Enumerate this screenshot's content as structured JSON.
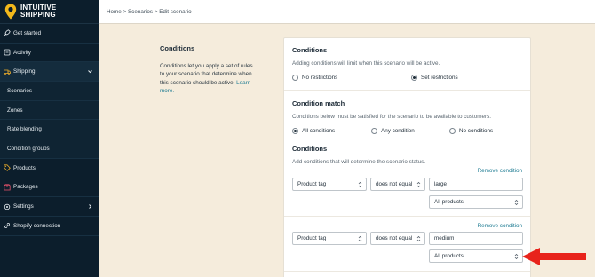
{
  "brand": {
    "line1": "INTUITIVE",
    "line2": "SHIPPING"
  },
  "sidebar": {
    "items": [
      {
        "label": "Get started",
        "icon": "rocket-icon",
        "type": "main"
      },
      {
        "label": "Activity",
        "icon": "activity-icon",
        "type": "main"
      },
      {
        "label": "Shipping",
        "icon": "truck-icon",
        "type": "main",
        "expanded": true
      },
      {
        "label": "Scenarios",
        "type": "sub"
      },
      {
        "label": "Zones",
        "type": "sub"
      },
      {
        "label": "Rate blending",
        "type": "sub"
      },
      {
        "label": "Condition groups",
        "type": "sub"
      },
      {
        "label": "Products",
        "icon": "tag-icon",
        "type": "main"
      },
      {
        "label": "Packages",
        "icon": "package-icon",
        "type": "main"
      },
      {
        "label": "Settings",
        "icon": "gear-icon",
        "type": "main",
        "collapsed": true
      },
      {
        "label": "Shopify connection",
        "icon": "link-icon",
        "type": "main"
      }
    ]
  },
  "breadcrumb": {
    "home": "Home",
    "scenarios": "Scenarios",
    "current": "Edit scenario",
    "separator": " > "
  },
  "intro": {
    "title": "Conditions",
    "text": "Conditions let you apply a set of rules to your scenario that determine when this scenario should be active.",
    "link": "Learn more."
  },
  "conditions_section": {
    "title": "Conditions",
    "help": "Adding conditions will limit when this scenario will be active.",
    "options": [
      "No restrictions",
      "Set restrictions"
    ],
    "selected": "Set restrictions"
  },
  "match_section": {
    "title": "Condition match",
    "help": "Conditions below must be satisfied for the scenario to be available to customers.",
    "options": [
      "All conditions",
      "Any condition",
      "No conditions"
    ],
    "selected": "All conditions"
  },
  "rules_section": {
    "title": "Conditions",
    "help": "Add conditions that will determine the scenario status.",
    "remove_label": "Remove condition",
    "rules": [
      {
        "field": "Product tag",
        "operator": "does not equal",
        "value": "large",
        "scope": "All products"
      },
      {
        "field": "Product tag",
        "operator": "does not equal",
        "value": "medium",
        "scope": "All products"
      }
    ]
  },
  "colors": {
    "accent": "#1f7c93",
    "sidebar": "#0c1e2c",
    "background": "#f5ecdc",
    "arrow": "#e8231b"
  }
}
